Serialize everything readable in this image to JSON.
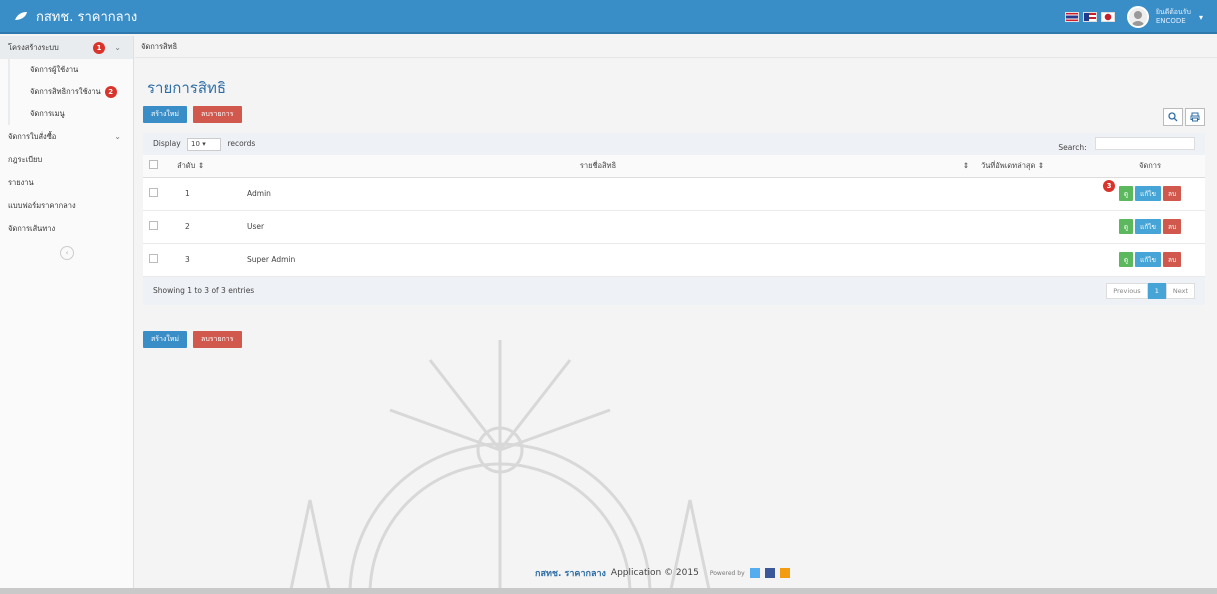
{
  "app": {
    "title": "กสทช. ราคากลาง"
  },
  "header": {
    "flags": [
      "thai-flag-icon",
      "english-flag-icon",
      "japanese-flag-icon"
    ],
    "user": {
      "name": "ยินดีต้อนรับ",
      "sub": "ENCODE"
    }
  },
  "sidebar": {
    "items": [
      {
        "label": "โครงสร้างระบบ",
        "marker": "1",
        "active": true
      },
      {
        "label": "จัดการผู้ใช้งาน"
      },
      {
        "label": "จัดการสิทธิการใช้งาน",
        "marker": "2"
      },
      {
        "label": "จัดการเมนู"
      },
      {
        "label": "จัดการใบสั่งซื้อ"
      },
      {
        "label": "กฎระเบียบ"
      },
      {
        "label": "รายงาน"
      },
      {
        "label": "แบบฟอร์มราคากลาง"
      },
      {
        "label": "จัดการเส้นทาง"
      }
    ]
  },
  "breadcrumb": "จัดการสิทธิ",
  "page": {
    "title": "รายการสิทธิ"
  },
  "actions": {
    "create": "สร้างใหม่",
    "delete": "ลบรายการ"
  },
  "table": {
    "display_label": "Display",
    "display_value": "10",
    "records_label": "records",
    "search_label": "Search:",
    "headers": [
      "ลำดับ ⇕",
      "รายชื่อสิทธิ",
      "⇕",
      "วันที่อัพเดทล่าสุด ⇕",
      "จัดการ"
    ],
    "rows": [
      {
        "no": "1",
        "name": "Admin"
      },
      {
        "no": "2",
        "name": "User"
      },
      {
        "no": "3",
        "name": "Super Admin"
      }
    ],
    "row_actions": {
      "view": "ดู",
      "edit": "แก้ไข",
      "delete": "ลบ"
    },
    "row_marker": "3",
    "showing": "Showing 1 to 3 of 3 entries",
    "pager": {
      "prev": "Previous",
      "current": "1",
      "next": "Next"
    }
  },
  "footer": {
    "brand": "กสทช. ราคากลาง",
    "text": "Application © 2015",
    "powered": "Powered by"
  },
  "colors": {
    "primary": "#3a8ec8",
    "danger": "#d0584c",
    "success": "#5cb85c",
    "marker": "#d9342b"
  }
}
